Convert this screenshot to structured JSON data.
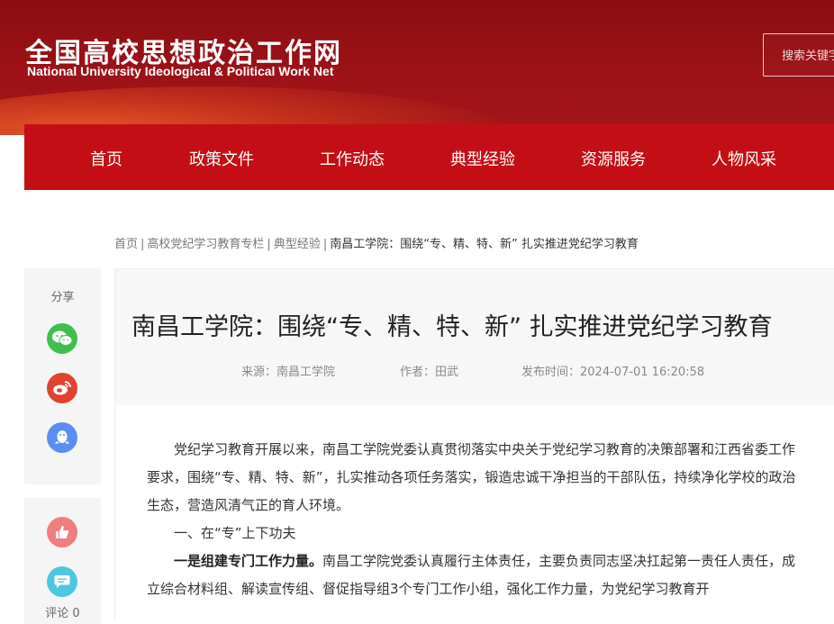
{
  "header": {
    "logo_cn": "全国高校思想政治工作网",
    "logo_en": "National University Ideological & Political Work Net",
    "search_placeholder": "搜索关键字"
  },
  "nav": {
    "items": [
      {
        "label": "首页"
      },
      {
        "label": "政策文件"
      },
      {
        "label": "工作动态"
      },
      {
        "label": "典型经验"
      },
      {
        "label": "资源服务"
      },
      {
        "label": "人物风采"
      }
    ]
  },
  "breadcrumb": {
    "items": [
      "首页",
      "高校党纪学习教育专栏",
      "典型经验"
    ],
    "current": "南昌工学院：围绕“专、精、特、新” 扎实推进党纪学习教育",
    "separator": "|"
  },
  "share": {
    "label": "分享",
    "icons": [
      "wechat-icon",
      "weibo-icon",
      "qq-icon"
    ],
    "colors": {
      "wechat": "#3fbf4e",
      "weibo": "#e0432f",
      "qq": "#5b8ef0"
    }
  },
  "actions": {
    "like_color": "#ef7e7e",
    "comment_color": "#4fc6df",
    "comment_label": "评论 0"
  },
  "article": {
    "title": "南昌工学院：围绕“专、精、特、新” 扎实推进党纪学习教育",
    "source": "来源：南昌工学院",
    "author": "作者：田武",
    "published": "发布时间：2024-07-01 16:20:58",
    "paragraphs": {
      "p1": "党纪学习教育开展以来，南昌工学院党委认真贯彻落实中央关于党纪学习教育的决策部署和江西省委工作要求，围绕“专、精、特、新”，扎实推动各项任务落实，锻造忠诚干净担当的干部队伍，持续净化学校的政治生态，营造风清气正的育人环境。",
      "p2": "一、在“专”上下功夫",
      "p3_bold": "一是组建专门工作力量。",
      "p3_rest": "南昌工学院党委认真履行主体责任，主要负责同志坚决扛起第一责任人责任，成立综合材料组、解读宣传组、督促指导组3个专门工作小组，强化工作力量，为党纪学习教育开"
    }
  },
  "colors": {
    "brand_red": "#c40e15",
    "banner_dark": "#8a0d12"
  }
}
